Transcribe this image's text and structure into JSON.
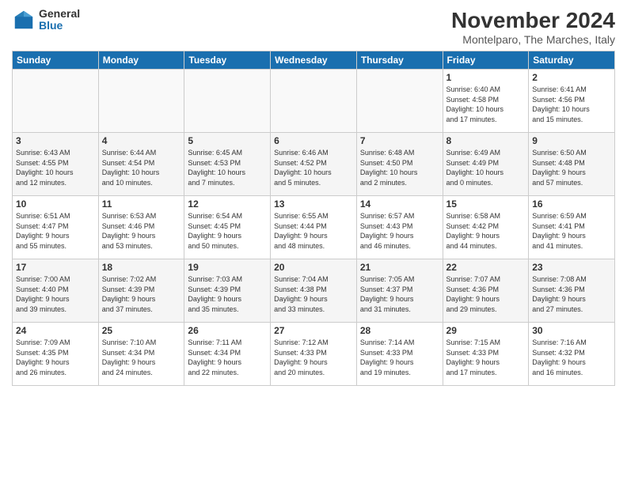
{
  "logo": {
    "general": "General",
    "blue": "Blue"
  },
  "title": {
    "month": "November 2024",
    "location": "Montelparo, The Marches, Italy"
  },
  "headers": [
    "Sunday",
    "Monday",
    "Tuesday",
    "Wednesday",
    "Thursday",
    "Friday",
    "Saturday"
  ],
  "weeks": [
    [
      {
        "day": "",
        "info": ""
      },
      {
        "day": "",
        "info": ""
      },
      {
        "day": "",
        "info": ""
      },
      {
        "day": "",
        "info": ""
      },
      {
        "day": "",
        "info": ""
      },
      {
        "day": "1",
        "info": "Sunrise: 6:40 AM\nSunset: 4:58 PM\nDaylight: 10 hours\nand 17 minutes."
      },
      {
        "day": "2",
        "info": "Sunrise: 6:41 AM\nSunset: 4:56 PM\nDaylight: 10 hours\nand 15 minutes."
      }
    ],
    [
      {
        "day": "3",
        "info": "Sunrise: 6:43 AM\nSunset: 4:55 PM\nDaylight: 10 hours\nand 12 minutes."
      },
      {
        "day": "4",
        "info": "Sunrise: 6:44 AM\nSunset: 4:54 PM\nDaylight: 10 hours\nand 10 minutes."
      },
      {
        "day": "5",
        "info": "Sunrise: 6:45 AM\nSunset: 4:53 PM\nDaylight: 10 hours\nand 7 minutes."
      },
      {
        "day": "6",
        "info": "Sunrise: 6:46 AM\nSunset: 4:52 PM\nDaylight: 10 hours\nand 5 minutes."
      },
      {
        "day": "7",
        "info": "Sunrise: 6:48 AM\nSunset: 4:50 PM\nDaylight: 10 hours\nand 2 minutes."
      },
      {
        "day": "8",
        "info": "Sunrise: 6:49 AM\nSunset: 4:49 PM\nDaylight: 10 hours\nand 0 minutes."
      },
      {
        "day": "9",
        "info": "Sunrise: 6:50 AM\nSunset: 4:48 PM\nDaylight: 9 hours\nand 57 minutes."
      }
    ],
    [
      {
        "day": "10",
        "info": "Sunrise: 6:51 AM\nSunset: 4:47 PM\nDaylight: 9 hours\nand 55 minutes."
      },
      {
        "day": "11",
        "info": "Sunrise: 6:53 AM\nSunset: 4:46 PM\nDaylight: 9 hours\nand 53 minutes."
      },
      {
        "day": "12",
        "info": "Sunrise: 6:54 AM\nSunset: 4:45 PM\nDaylight: 9 hours\nand 50 minutes."
      },
      {
        "day": "13",
        "info": "Sunrise: 6:55 AM\nSunset: 4:44 PM\nDaylight: 9 hours\nand 48 minutes."
      },
      {
        "day": "14",
        "info": "Sunrise: 6:57 AM\nSunset: 4:43 PM\nDaylight: 9 hours\nand 46 minutes."
      },
      {
        "day": "15",
        "info": "Sunrise: 6:58 AM\nSunset: 4:42 PM\nDaylight: 9 hours\nand 44 minutes."
      },
      {
        "day": "16",
        "info": "Sunrise: 6:59 AM\nSunset: 4:41 PM\nDaylight: 9 hours\nand 41 minutes."
      }
    ],
    [
      {
        "day": "17",
        "info": "Sunrise: 7:00 AM\nSunset: 4:40 PM\nDaylight: 9 hours\nand 39 minutes."
      },
      {
        "day": "18",
        "info": "Sunrise: 7:02 AM\nSunset: 4:39 PM\nDaylight: 9 hours\nand 37 minutes."
      },
      {
        "day": "19",
        "info": "Sunrise: 7:03 AM\nSunset: 4:39 PM\nDaylight: 9 hours\nand 35 minutes."
      },
      {
        "day": "20",
        "info": "Sunrise: 7:04 AM\nSunset: 4:38 PM\nDaylight: 9 hours\nand 33 minutes."
      },
      {
        "day": "21",
        "info": "Sunrise: 7:05 AM\nSunset: 4:37 PM\nDaylight: 9 hours\nand 31 minutes."
      },
      {
        "day": "22",
        "info": "Sunrise: 7:07 AM\nSunset: 4:36 PM\nDaylight: 9 hours\nand 29 minutes."
      },
      {
        "day": "23",
        "info": "Sunrise: 7:08 AM\nSunset: 4:36 PM\nDaylight: 9 hours\nand 27 minutes."
      }
    ],
    [
      {
        "day": "24",
        "info": "Sunrise: 7:09 AM\nSunset: 4:35 PM\nDaylight: 9 hours\nand 26 minutes."
      },
      {
        "day": "25",
        "info": "Sunrise: 7:10 AM\nSunset: 4:34 PM\nDaylight: 9 hours\nand 24 minutes."
      },
      {
        "day": "26",
        "info": "Sunrise: 7:11 AM\nSunset: 4:34 PM\nDaylight: 9 hours\nand 22 minutes."
      },
      {
        "day": "27",
        "info": "Sunrise: 7:12 AM\nSunset: 4:33 PM\nDaylight: 9 hours\nand 20 minutes."
      },
      {
        "day": "28",
        "info": "Sunrise: 7:14 AM\nSunset: 4:33 PM\nDaylight: 9 hours\nand 19 minutes."
      },
      {
        "day": "29",
        "info": "Sunrise: 7:15 AM\nSunset: 4:33 PM\nDaylight: 9 hours\nand 17 minutes."
      },
      {
        "day": "30",
        "info": "Sunrise: 7:16 AM\nSunset: 4:32 PM\nDaylight: 9 hours\nand 16 minutes."
      }
    ]
  ]
}
